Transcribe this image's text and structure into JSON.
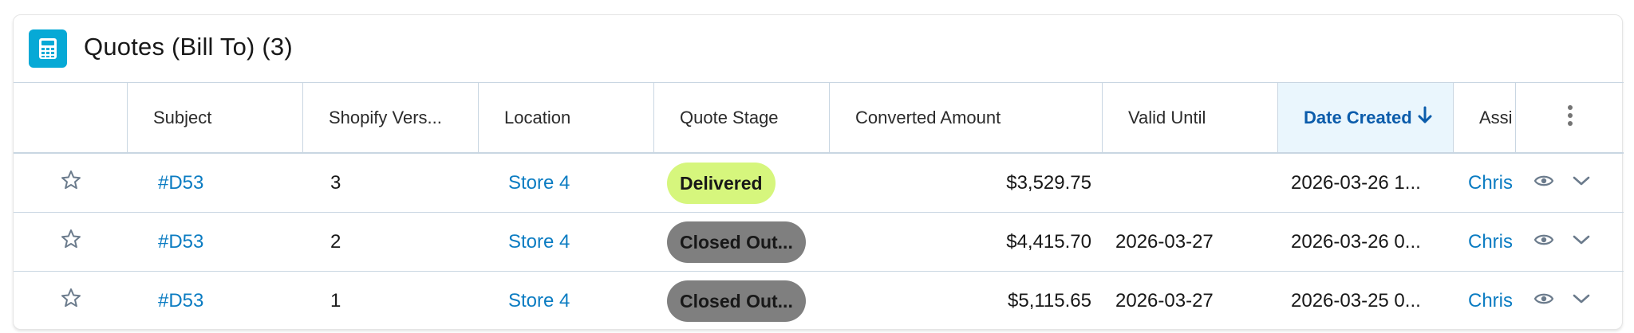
{
  "header": {
    "title": "Quotes (Bill To) (3)",
    "icon": "calculator-icon",
    "icon_color": "#06a9d6"
  },
  "columns": {
    "subject": "Subject",
    "shopify": "Shopify Vers...",
    "location": "Location",
    "stage": "Quote Stage",
    "amount": "Converted Amount",
    "valid": "Valid Until",
    "date": "Date Created",
    "assign": "Assi"
  },
  "sort": {
    "column": "Date Created",
    "direction": "descending"
  },
  "rows": [
    {
      "subject": "#D53",
      "shopify": "3",
      "location": "Store 4",
      "stage": "Delivered",
      "amount": "$3,529.75",
      "valid": "",
      "date": "2026-03-26 1...",
      "assign": "Chris"
    },
    {
      "subject": "#D53",
      "shopify": "2",
      "location": "Store 4",
      "stage": "Closed Out...",
      "amount": "$4,415.70",
      "valid": "2026-03-27",
      "date": "2026-03-26 0...",
      "assign": "Chris"
    },
    {
      "subject": "#D53",
      "shopify": "1",
      "location": "Store 4",
      "stage": "Closed Out...",
      "amount": "$5,115.65",
      "valid": "2026-03-27",
      "date": "2026-03-25 0...",
      "assign": "Chris"
    }
  ],
  "colors": {
    "link": "#0b7cc2",
    "delivered_pill": "#d6f67d",
    "closed_pill": "#7f7f7f",
    "sorted_header_bg": "#eaf6fd",
    "sorted_header_text": "#0b5cab"
  }
}
